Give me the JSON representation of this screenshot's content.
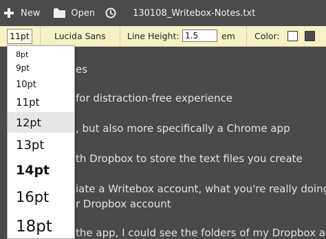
{
  "toolbar": {
    "new_label": "New",
    "open_label": "Open",
    "filename": "130108_Writebox-Notes.txt"
  },
  "format_bar": {
    "font_size_value": "11pt",
    "font_family": "Lucida Sans",
    "line_height_label": "Line Height:",
    "line_height_value": "1.5",
    "line_height_unit": "em",
    "color_label": "Color:",
    "text_color_swatch": "#ffffff",
    "background_color_swatch": "#4d4d4d"
  },
  "editor": {
    "lines": [
      "es",
      "for distraction-free experience",
      ", but also more specifically a Chrome app",
      "th Dropbox to store the text files you create",
      "iate a Writebox account, what you're really doing i",
      "r Dropbox account",
      "the app, I could see the folders of my Dropbox acc"
    ]
  },
  "font_size_dropdown": {
    "options": [
      "8pt",
      "9pt",
      "10pt",
      "11pt",
      "12pt",
      "13pt",
      "14pt",
      "16pt",
      "18pt"
    ],
    "highlighted": "12pt"
  },
  "colors": {
    "topbar_bg": "#4b4b4b",
    "format_bar_bg": "#f7f2c6",
    "editor_bg": "#4a4a4a",
    "editor_text": "#e2e2e2"
  }
}
